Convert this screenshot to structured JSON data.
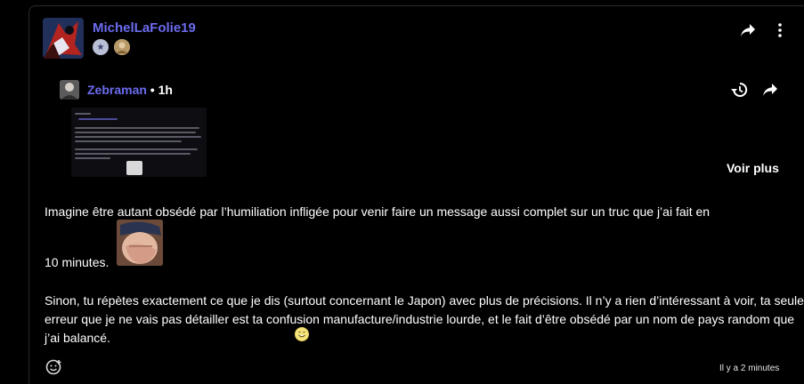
{
  "post": {
    "author": "MichelLaFolie19",
    "badges": [
      "star-badge",
      "avatar-badge"
    ]
  },
  "quote": {
    "author": "Zebraman",
    "separator": " • ",
    "time": "1h",
    "show_more": "Voir plus"
  },
  "body": {
    "line1": "Imagine être autant obsédé par l’humiliation infligée pour venir faire un message aussi complet sur un truc que j’ai fait en",
    "line1b": "10 minutes.",
    "paragraph2": "Sinon, tu répètes exactement ce que je dis (surtout concernant le Japon) avec plus de précisions. Il n’y a rien d’intéressant à voir, ta seule erreur que je ne vais pas détailler est ta confusion manufacture/industrie lourde, et le fait d’être obsédé par un nom de pays random que j’ai balancé."
  },
  "footer": {
    "timestamp": "Il y a 2 minutes"
  },
  "icons": {
    "share": "share-icon",
    "more": "more-vertical-icon",
    "history": "history-icon",
    "react": "add-reaction-icon"
  },
  "colors": {
    "accent": "#6b6bf0",
    "background": "#000000",
    "text": "#ffffff"
  }
}
